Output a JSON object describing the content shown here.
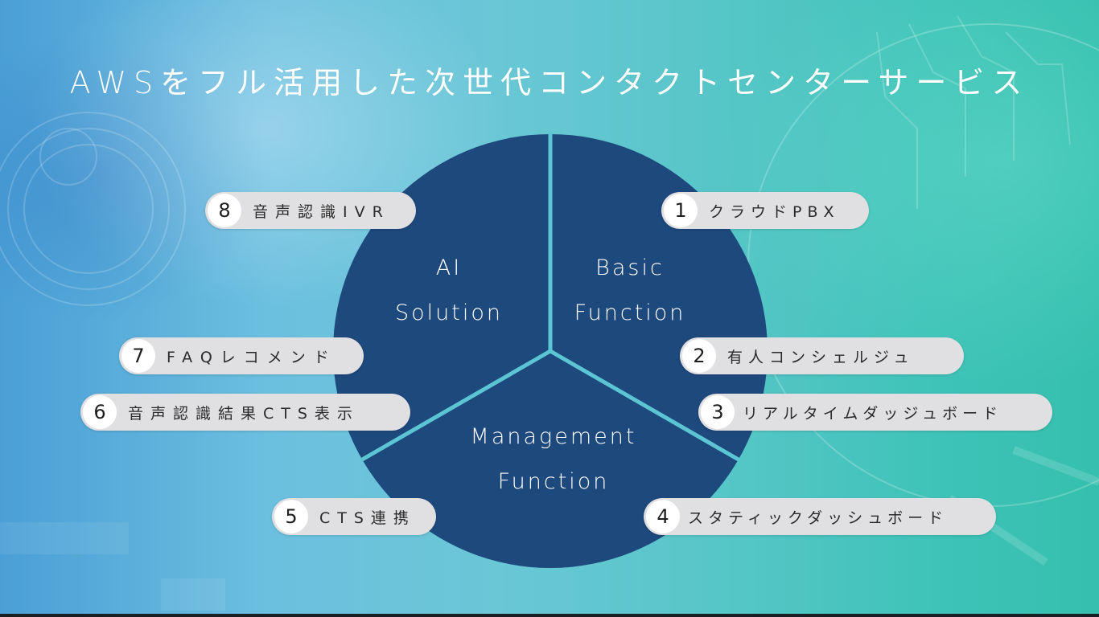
{
  "title": "AWSをフル活用した次世代コンタクトセンターサービス",
  "colors": {
    "segment_fill": "#1e497d",
    "divider": "#5cc5d4",
    "pill_bg": "#e0e0e2",
    "number_bg": "#ffffff",
    "title_text": "#ffffff"
  },
  "segments": [
    {
      "id": "ai",
      "line1": "AI",
      "line2": "Solution"
    },
    {
      "id": "basic",
      "line1": "Basic",
      "line2": "Function"
    },
    {
      "id": "management",
      "line1": "Management",
      "line2": "Function"
    }
  ],
  "features": [
    {
      "number": "1",
      "label": "クラウドPBX",
      "segment": "Basic Function"
    },
    {
      "number": "2",
      "label": "有人コンシェルジュ",
      "segment": "Basic Function"
    },
    {
      "number": "3",
      "label": "リアルタイムダッジュボード",
      "segment": "Basic Function"
    },
    {
      "number": "4",
      "label": "スタティックダッシュボード",
      "segment": "Management Function"
    },
    {
      "number": "5",
      "label": "CTS連携",
      "segment": "Management Function"
    },
    {
      "number": "6",
      "label": "音声認識結果CTS表示",
      "segment": "AI Solution"
    },
    {
      "number": "7",
      "label": "FAQレコメンド",
      "segment": "AI Solution"
    },
    {
      "number": "8",
      "label": "音声認識IVR",
      "segment": "AI Solution"
    }
  ]
}
